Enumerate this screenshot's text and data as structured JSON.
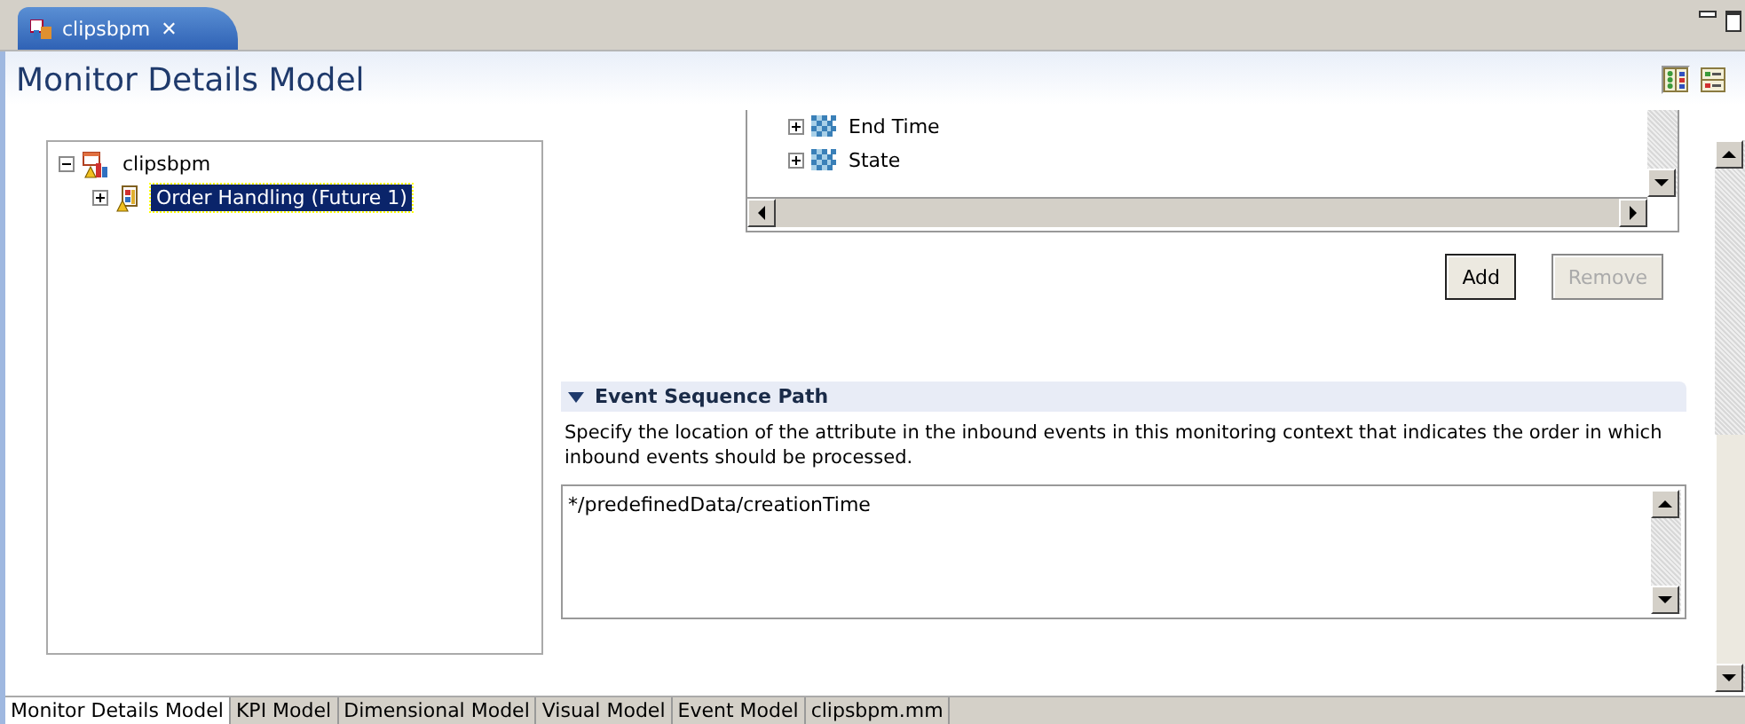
{
  "editor_tab": {
    "title": "clipsbpm",
    "close": "✕",
    "selected": true
  },
  "page_title": "Monitor Details Model",
  "layout_buttons": [
    {
      "kind": "columns",
      "selected": true
    },
    {
      "kind": "rows",
      "selected": false
    }
  ],
  "model_tree": [
    {
      "label": "clipsbpm",
      "expanded": true,
      "selected": false,
      "children": [
        {
          "label": "Order Handling (Future 1)",
          "expanded": false,
          "selected": true
        }
      ]
    }
  ],
  "attribute_tree": [
    {
      "label": "End Time",
      "expanded": false
    },
    {
      "label": "State",
      "expanded": false
    }
  ],
  "buttons": [
    {
      "label": "Add",
      "disabled": false
    },
    {
      "label": "Remove",
      "disabled": true
    }
  ],
  "section": {
    "title": "Event Sequence Path",
    "expanded": true,
    "description": "Specify the location of the attribute in the inbound events in this monitoring context that indicates the order in which inbound events should be processed.",
    "value": "*/predefinedData/creationTime"
  },
  "bottom_tabs": [
    {
      "label": "Monitor Details Model",
      "selected": true
    },
    {
      "label": "KPI Model",
      "selected": false
    },
    {
      "label": "Dimensional Model",
      "selected": false
    },
    {
      "label": "Visual Model",
      "selected": false
    },
    {
      "label": "Event Model",
      "selected": false
    },
    {
      "label": "clipsbpm.mm",
      "selected": false
    }
  ]
}
